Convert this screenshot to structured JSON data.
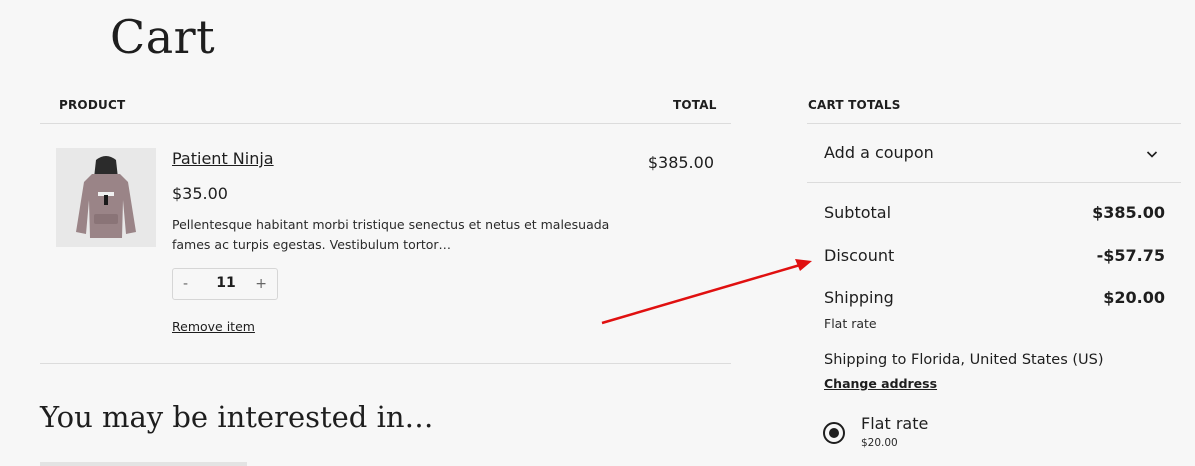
{
  "page": {
    "title": "Cart"
  },
  "table": {
    "product_header": "PRODUCT",
    "total_header": "TOTAL"
  },
  "item": {
    "name": "Patient Ninja",
    "price": "$35.00",
    "description": "Pellentesque habitant morbi tristique senectus et netus et malesuada fames ac turpis egestas. Vestibulum tortor…",
    "quantity": "11",
    "minus": "-",
    "plus": "+",
    "remove_label": "Remove item",
    "line_total": "$385.00"
  },
  "related": {
    "heading": "You may be interested in…"
  },
  "totals": {
    "heading": "CART TOTALS",
    "coupon_label": "Add a coupon",
    "subtotal_label": "Subtotal",
    "subtotal_value": "$385.00",
    "discount_label": "Discount",
    "discount_value": "-$57.75",
    "shipping_label": "Shipping",
    "shipping_value": "$20.00",
    "shipping_method": "Flat rate",
    "shipping_to": "Shipping to Florida, United States (US)",
    "change_address": "Change address",
    "option_label": "Flat rate",
    "option_price": "$20.00"
  },
  "colors": {
    "annotation_arrow": "#e01010",
    "accent": "#1e1e1e"
  }
}
